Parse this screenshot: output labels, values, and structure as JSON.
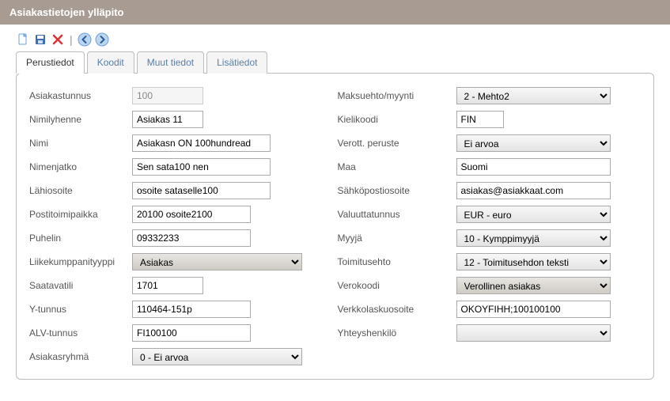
{
  "title": "Asiakastietojen ylläpito",
  "toolbar": {
    "new_icon": "new-document-icon",
    "save_icon": "save-icon",
    "delete_icon": "delete-icon",
    "prev_icon": "prev-icon",
    "next_icon": "next-icon"
  },
  "tabs": {
    "perustiedot": "Perustiedot",
    "koodit": "Koodit",
    "muut": "Muut tiedot",
    "lisatiedot": "Lisätiedot"
  },
  "left": {
    "asiakastunnus_label": "Asiakastunnus",
    "asiakastunnus_value": "100",
    "nimilyhenne_label": "Nimilyhenne",
    "nimilyhenne_value": "Asiakas 11",
    "nimi_label": "Nimi",
    "nimi_value": "Asiakasn ON 100hundread",
    "nimenjatko_label": "Nimenjatko",
    "nimenjatko_value": "Sen sata100 nen",
    "lahiosoite_label": "Lähiosoite",
    "lahiosoite_value": "osoite sataselle100",
    "postitoimipaikka_label": "Postitoimipaikka",
    "postitoimipaikka_value": "20100 osoite2100",
    "puhelin_label": "Puhelin",
    "puhelin_value": "09332233",
    "liikekumppanityyppi_label": "Liikekumppanityyppi",
    "liikekumppanityyppi_value": "Asiakas",
    "saatavatili_label": "Saatavatili",
    "saatavatili_value": "1701",
    "ytunnus_label": "Y-tunnus",
    "ytunnus_value": "110464-151p",
    "alvtunnus_label": "ALV-tunnus",
    "alvtunnus_value": "FI100100",
    "asiakasryhma_label": "Asiakasryhmä",
    "asiakasryhma_value": "0 - Ei arvoa"
  },
  "right": {
    "maksuehto_label": "Maksuehto/myynti",
    "maksuehto_value": "2 - Mehto2",
    "kielikoodi_label": "Kielikoodi",
    "kielikoodi_value": "FIN",
    "verottperuste_label": "Verott. peruste",
    "verottperuste_value": "Ei arvoa",
    "maa_label": "Maa",
    "maa_value": "Suomi",
    "sahkoposti_label": "Sähköpostiosoite",
    "sahkoposti_value": "asiakas@asiakkaat.com",
    "valuutta_label": "Valuuttatunnus",
    "valuutta_value": "EUR - euro",
    "myyja_label": "Myyjä",
    "myyja_value": "10 - Kymppimyyjä",
    "toimitusehto_label": "Toimitusehto",
    "toimitusehto_value": "12 - Toimitusehdon teksti",
    "verokoodi_label": "Verokoodi",
    "verokoodi_value": "Verollinen asiakas",
    "verkkolasku_label": "Verkkolaskuosoite",
    "verkkolasku_value": "OKOYFIHH;100100100",
    "yhteyshenkilo_label": "Yhteyshenkilö",
    "yhteyshenkilo_value": ""
  }
}
